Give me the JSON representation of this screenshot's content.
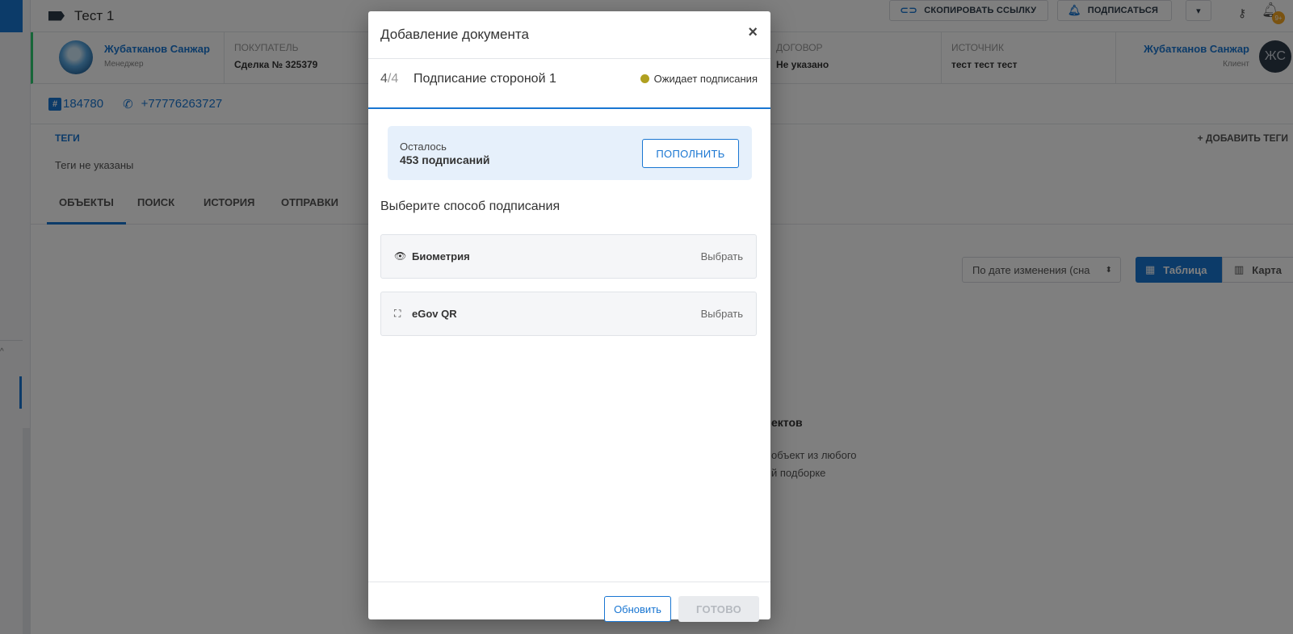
{
  "background": {
    "deal_title": "Тест 1",
    "toolbar": {
      "copy_link": "СКОПИРОВАТЬ ССЫЛКУ",
      "subscribe": "ПОДПИСАТЬСЯ",
      "notifications_badge": "9+"
    },
    "manager": {
      "name": "Жубатканов Санжар",
      "role": "Менеджер"
    },
    "info_columns": [
      {
        "key": "ПОКУПАТЕЛЬ",
        "value": "Сделка № 325379"
      },
      {
        "key": "ДОГОВОР",
        "value": "Не указано"
      },
      {
        "key": "ИСТОЧНИК",
        "value": "тест тест тест"
      }
    ],
    "client": {
      "name": "Жубатканов Санжар",
      "role": "Клиент",
      "initials": "ЖС"
    },
    "contact": {
      "id": "184780",
      "phone": "+77776263727"
    },
    "tags": {
      "heading": "ТЕГИ",
      "empty": "Теги не указаны",
      "add": "+ ДОБАВИТЬ ТЕГИ"
    },
    "tabs": [
      "ОБЪЕКТЫ",
      "ПОИСК",
      "ИСТОРИЯ",
      "ОТПРАВКИ"
    ],
    "sort_label": "По дате изменения (сна",
    "view_table": "Таблица",
    "view_map": "Карта",
    "empty_title": "ектов",
    "empty_line1": "объект из любого",
    "empty_line2": "й подборке"
  },
  "modal": {
    "title": "Добавление документа",
    "close": "×",
    "step": {
      "current": "4",
      "total": "/4",
      "name": "Подписание стороной 1",
      "status": "Ожидает подписания"
    },
    "balance": {
      "label": "Осталось",
      "count": "453 подписаний",
      "topup": "ПОПОЛНИТЬ"
    },
    "choose_title": "Выберите способ подписания",
    "methods": [
      {
        "name": "Биометрия",
        "icon": "eye-icon",
        "action": "Выбрать"
      },
      {
        "name": "eGov QR",
        "icon": "qr-scan-icon",
        "action": "Выбрать"
      }
    ],
    "buttons": {
      "refresh": "Обновить",
      "done": "ГОТОВО"
    }
  },
  "colors": {
    "accent": "#1976d2",
    "status_pending": "#b0a020",
    "balance_bg": "#e6f0fb",
    "lead_border": "#2ecc71"
  }
}
